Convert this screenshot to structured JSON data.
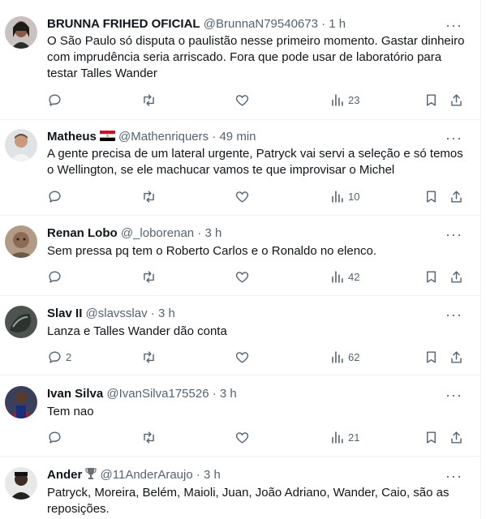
{
  "tweets": [
    {
      "name": "BRUNNA FRIHED OFICIAL",
      "handle": "@BrunnaN79540673",
      "dot": "·",
      "time": "1 h",
      "text": "O São Paulo só disputa o paulistão nesse primeiro momento. Gastar dinheiro com imprudência seria arriscado. Fora que pode usar de laboratório para testar Talles Wander",
      "replies": "",
      "views": "23"
    },
    {
      "name": "Matheus",
      "badge_icon": "egypt-flag-icon",
      "handle": "@Mathenriquers",
      "dot": "·",
      "time": "49 min",
      "text": "A gente precisa de um lateral urgente, Patryck vai servi a seleção e só temos o Wellington, se ele machucar vamos te que improvisar o Michel",
      "replies": "",
      "views": "10"
    },
    {
      "name": "Renan Lobo",
      "handle": "@_loborenan",
      "dot": "·",
      "time": "3 h",
      "text": "Sem pressa pq tem o Roberto Carlos e o Ronaldo no elenco.",
      "replies": "",
      "views": "42"
    },
    {
      "name": "Slav II",
      "handle": "@slavsslav",
      "dot": "·",
      "time": "3 h",
      "text": "Lanza e Talles Wander dão conta",
      "replies": "2",
      "views": "62"
    },
    {
      "name": "Ivan Silva",
      "handle": "@IvanSilva175526",
      "dot": "·",
      "time": "3 h",
      "text": "Tem nao",
      "replies": "",
      "views": "21"
    },
    {
      "name": "Ander",
      "badge_icon": "trophy-icon",
      "handle": "@11AnderAraujo",
      "dot": "·",
      "time": "3 h",
      "text": "Patryck, Moreira, Belém, Maioli, Juan, João Adriano, Wander, Caio, são as reposições.",
      "replies": "",
      "views": ""
    }
  ],
  "more_glyph": "···",
  "colors": {
    "secondary": "#536471",
    "primary": "#0f1419",
    "border": "#eff3f4"
  }
}
